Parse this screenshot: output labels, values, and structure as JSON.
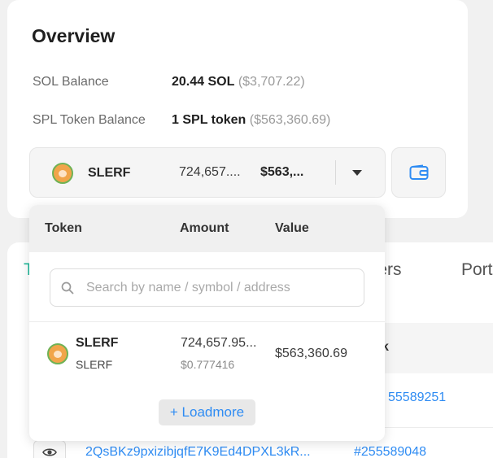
{
  "overview": {
    "title": "Overview",
    "sol_label": "SOL Balance",
    "sol_amount": "20.44 SOL",
    "sol_usd": "($3,707.22)",
    "spl_label": "SPL Token Balance",
    "spl_amount": "1 SPL token",
    "spl_usd": "($563,360.69)"
  },
  "token_select": {
    "icon": "slerf-token-icon",
    "name": "SLERF",
    "amount": "724,657....",
    "value": "$563,..."
  },
  "wallet_button": {
    "icon": "wallet-icon"
  },
  "background": {
    "tab_partial": "T",
    "tab_transfers": "sfers",
    "tab_portfolio": "Port",
    "table_header_partial": "k",
    "row1_block": "55589251",
    "row2_signature": "2QsBKz9pxizibjqfE7K9Ed4DPXL3kR...",
    "row2_block": "#255589048"
  },
  "dropdown": {
    "columns": {
      "token": "Token",
      "amount": "Amount",
      "value": "Value"
    },
    "search_placeholder": "Search by name / symbol / address",
    "items": [
      {
        "name": "SLERF",
        "symbol": "SLERF",
        "amount": "724,657.95...",
        "price": "$0.777416",
        "value": "$563,360.69"
      }
    ],
    "load_more": "+ Loadmore"
  },
  "colors": {
    "accent_link": "#2f8cf3",
    "accent_tab": "#1fb89a"
  }
}
